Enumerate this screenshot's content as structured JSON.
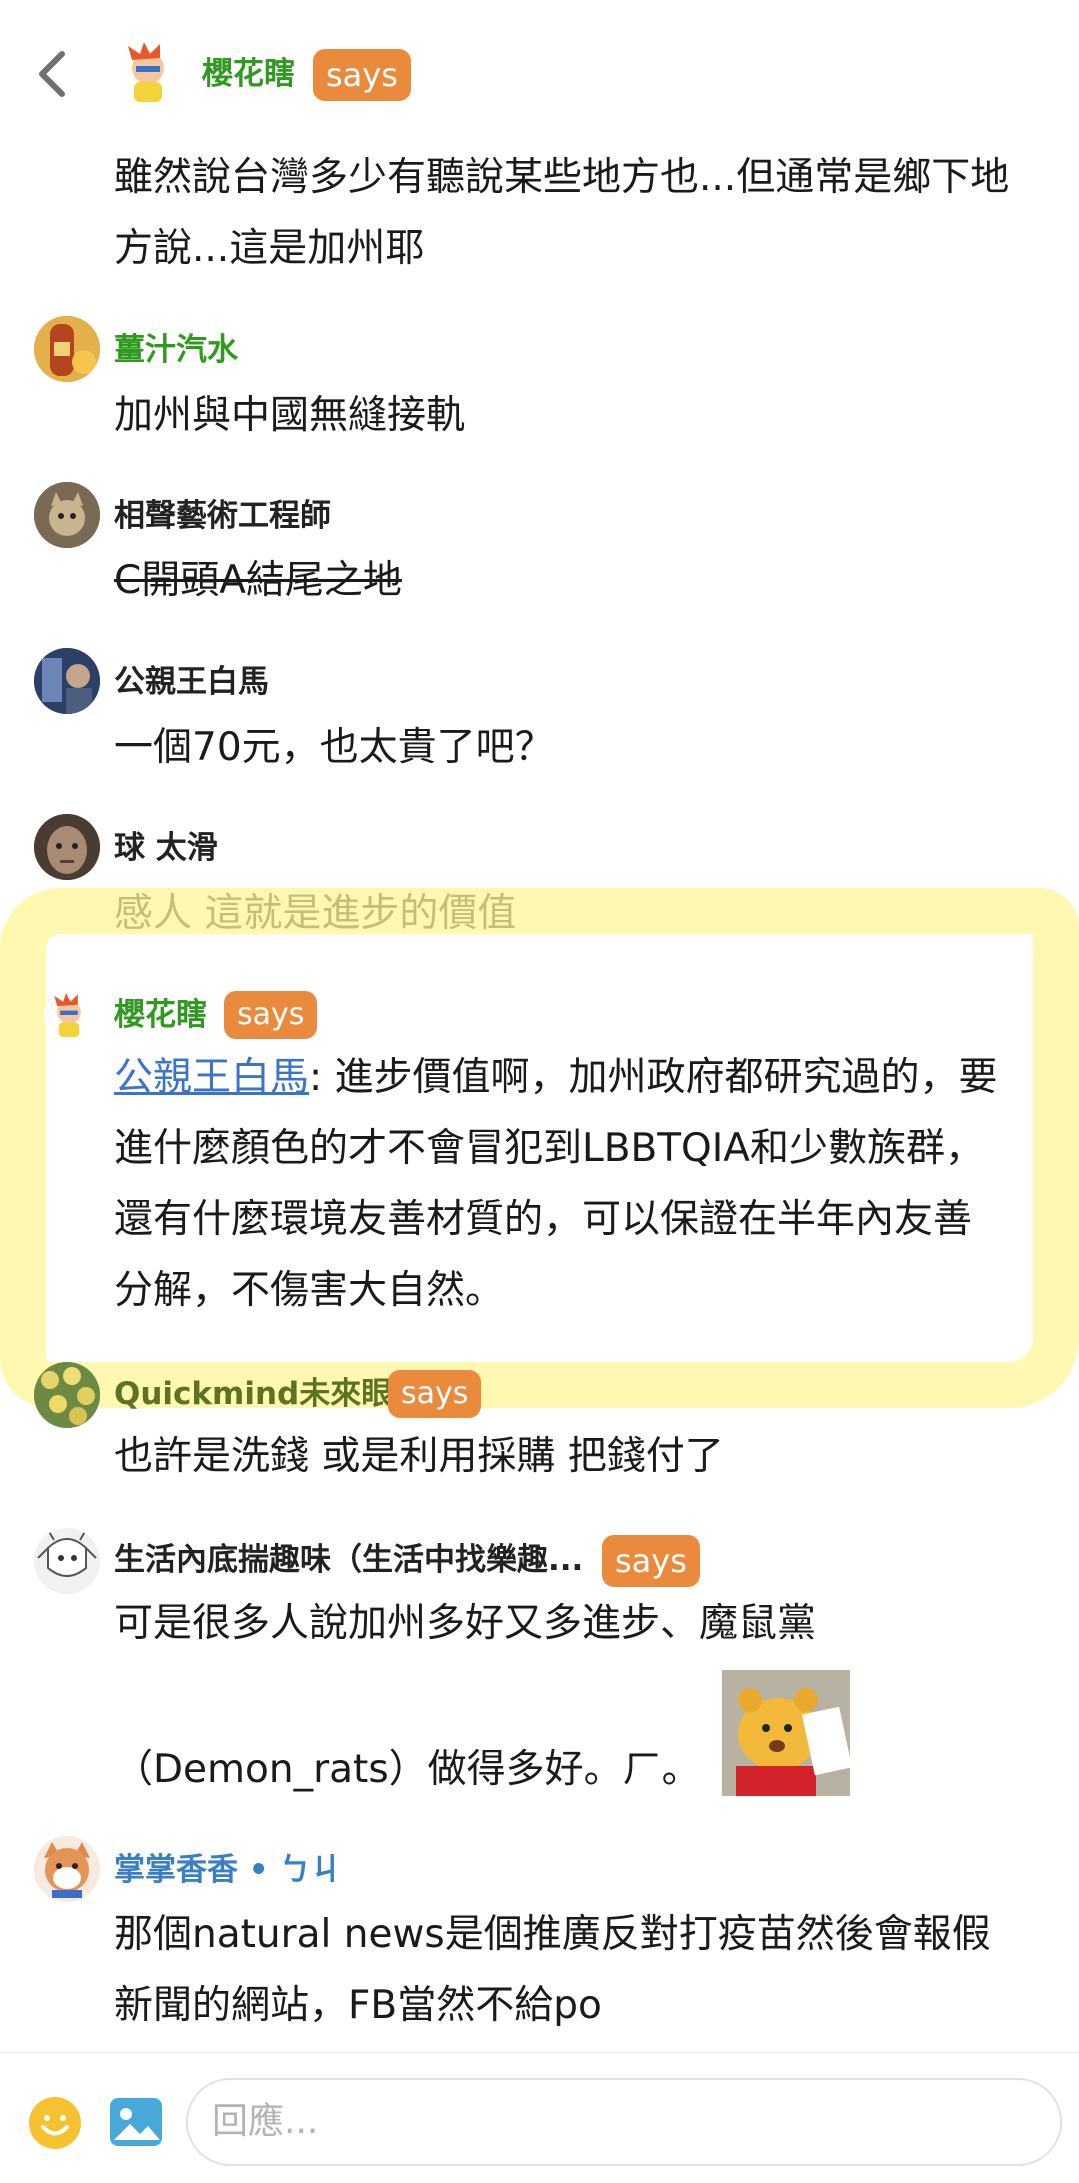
{
  "nav": {
    "back_icon": "chevron-left-icon"
  },
  "posts": [
    {
      "user": "櫻花瞎",
      "badge": "says",
      "lines": [
        "雖然說台灣多少有聽說某些地方也...但通常是鄉下地",
        "方說...這是加州耶"
      ]
    },
    {
      "user": "薑汁汽水",
      "lines": [
        "加州與中國無縫接軌"
      ]
    },
    {
      "user": "相聲藝術工程師",
      "lines": [
        "C開頭A結尾之地"
      ]
    },
    {
      "user": "公親王白馬",
      "lines": [
        "一個70元，也太貴了吧？"
      ]
    },
    {
      "user": "球 太滑",
      "lines": [
        "感人 這就是進步的價值"
      ]
    },
    {
      "user": "櫻花瞎",
      "badge": "says",
      "mention": "公親王白馬",
      "first_rest": ": 進步價值啊，加州政府都研究過的，要",
      "lines": [
        "進什麼顏色的才不會冒犯到LBBTQIA和少數族群，",
        "還有什麼環境友善材質的，可以保證在半年內友善",
        "分解，不傷害大自然。"
      ]
    },
    {
      "user": "Quickmind未來眼",
      "badge": "says",
      "lines": [
        "也許是洗錢 或是利用採購 把錢付了"
      ]
    },
    {
      "user": "生活內底揣趣味（生活中找樂趣...",
      "badge": "says",
      "lines": [
        "可是很多人說加州多好又多進步、魔鼠黨",
        "（Demon_rats）做得多好。ㄏ。"
      ]
    },
    {
      "user": "掌掌香香 • ㄅㄐ",
      "lines": [
        "那個natural news是個推廣反對打疫苗然後會報假",
        "新聞的網站，FB當然不給po"
      ]
    }
  ],
  "reply": {
    "placeholder": "回應..."
  },
  "colors": {
    "accent_green": "#2f9a1f",
    "badge_orange": "#e98a3c",
    "highlight": "#fff696",
    "link_blue": "#3a73c8"
  }
}
